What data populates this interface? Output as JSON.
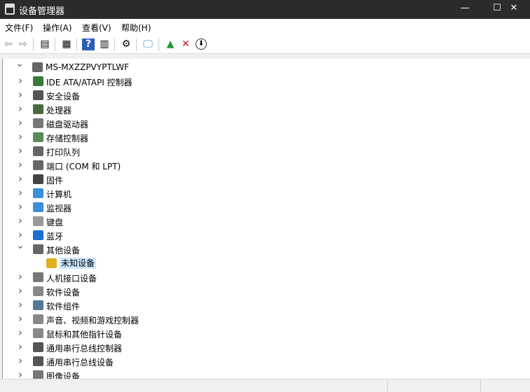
{
  "window": {
    "title": "设备管理器",
    "minimize": "—",
    "maximize": "☐",
    "close": "✕"
  },
  "menu": [
    "文件(F)",
    "操作(A)",
    "查看(V)",
    "帮助(H)"
  ],
  "toolbar": [
    {
      "name": "back-icon",
      "glyph": "⇦"
    },
    {
      "name": "forward-icon",
      "glyph": "⇨"
    },
    {
      "name": "show-hide-console-tree-icon",
      "glyph": "▤"
    },
    {
      "name": "properties-icon",
      "glyph": "▦"
    },
    {
      "name": "help-icon",
      "glyph": "?"
    },
    {
      "name": "action-pane-icon",
      "glyph": "▥"
    },
    {
      "name": "update-driver-icon",
      "glyph": "⚙"
    },
    {
      "name": "scan-hardware-icon",
      "glyph": "🖵"
    },
    {
      "name": "enable-device-icon",
      "glyph": "▲"
    },
    {
      "name": "uninstall-device-icon",
      "glyph": "✕"
    },
    {
      "name": "disable-device-icon",
      "glyph": "⬇"
    }
  ],
  "tree": {
    "root": "MS-MXZZPVYPTLWF",
    "items": [
      {
        "label": "IDE ATA/ATAPI 控制器",
        "color": "#3a7a3a",
        "expanded": false
      },
      {
        "label": "安全设备",
        "color": "#555555",
        "expanded": false
      },
      {
        "label": "处理器",
        "color": "#4a6a3a",
        "expanded": false
      },
      {
        "label": "磁盘驱动器",
        "color": "#777777",
        "expanded": false
      },
      {
        "label": "存储控制器",
        "color": "#5a8a5a",
        "expanded": false
      },
      {
        "label": "打印队列",
        "color": "#666666",
        "expanded": false
      },
      {
        "label": "端口 (COM 和 LPT)",
        "color": "#666666",
        "expanded": false
      },
      {
        "label": "固件",
        "color": "#444444",
        "expanded": false
      },
      {
        "label": "计算机",
        "color": "#3a8fd8",
        "expanded": false
      },
      {
        "label": "监视器",
        "color": "#3a8fd8",
        "expanded": false
      },
      {
        "label": "键盘",
        "color": "#999999",
        "expanded": false
      },
      {
        "label": "蓝牙",
        "color": "#1e6fd0",
        "expanded": false
      },
      {
        "label": "其他设备",
        "color": "#666666",
        "expanded": true,
        "children": [
          {
            "label": "未知设备",
            "color": "#e0b020",
            "selected": true
          }
        ]
      },
      {
        "label": "人机接口设备",
        "color": "#777777",
        "expanded": false
      },
      {
        "label": "软件设备",
        "color": "#888888",
        "expanded": false
      },
      {
        "label": "软件组件",
        "color": "#557799",
        "expanded": false
      },
      {
        "label": "声音、视频和游戏控制器",
        "color": "#888888",
        "expanded": false
      },
      {
        "label": "鼠标和其他指针设备",
        "color": "#888888",
        "expanded": false
      },
      {
        "label": "通用串行总线控制器",
        "color": "#555555",
        "expanded": false
      },
      {
        "label": "通用串行总线设备",
        "color": "#555555",
        "expanded": false
      },
      {
        "label": "图像设备",
        "color": "#777777",
        "expanded": false
      }
    ]
  },
  "colors": {
    "titlebar": "#2b2b2b",
    "selection": "#cce8ff",
    "uninstall": "#d0121b"
  }
}
